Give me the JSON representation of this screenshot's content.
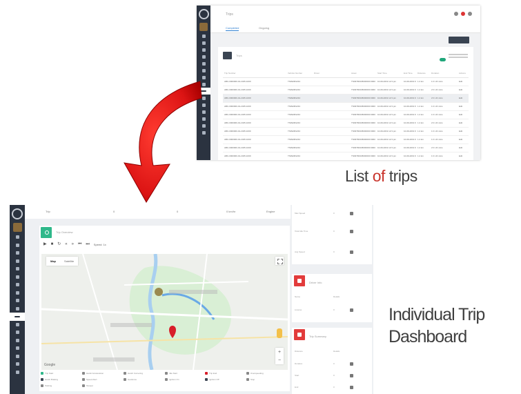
{
  "list_screenshot": {
    "breadcrumb": "Trips",
    "tabs": [
      "Completed",
      "Ongoing"
    ],
    "search_placeholder": "Trips",
    "columns": [
      "Trip Number",
      "Vehicle Number",
      "Driver",
      "Asset",
      "Start Time",
      "End Time",
      "Distance",
      "Duration",
      "Actions"
    ],
    "rows": [
      [
        "ABC-0000000-01-2345-1000",
        "TN09AB1234",
        "TN09782345000000 0000",
        "10-09-2019 12:3 pm",
        "10-09-2019 03:45 pm",
        "1.2 km",
        "1 hr 24 mins",
        "Edit"
      ],
      [
        "ABC-0000000-01-2345-1000",
        "TN09AB1234",
        "TN09782345000000 0000",
        "10-09-2019 12:3 pm",
        "10-09-2019 03:45 pm",
        "1.2 km",
        "2 hr 24 mins",
        "Edit"
      ],
      [
        "ABC-0000000-01-2345-1000",
        "TN09AB1234",
        "TN09782345000000 0000",
        "10-09-2019 12:3 pm",
        "10-09-2019 03:45 pm",
        "1.2 km",
        "2 hr 24 mins",
        "Edit"
      ],
      [
        "ABC-0000000-01-2345-1000",
        "TN09AB1234",
        "TN09782345000000 0000",
        "10-09-2019 12:3 pm",
        "10-09-2019 03:45 pm",
        "1.2 km",
        "1 hr 24 mins",
        "Edit"
      ],
      [
        "ABC-0000000-01-2345-1000",
        "TN09AB1234",
        "TN09782345000000 0000",
        "10-09-2019 12:3 pm",
        "10-09-2019 03:45 pm",
        "1.2 km",
        "1 hr 24 mins",
        "Edit"
      ],
      [
        "ABC-0000000-01-2345-1000",
        "TN09AB1234",
        "TN09782345000000 0000",
        "10-09-2019 12:3 pm",
        "10-09-2019 03:45 pm",
        "1.2 km",
        "2 hr 24 mins",
        "Edit"
      ],
      [
        "ABC-0000000-01-2345-1000",
        "TN09AB1234",
        "TN09782345000000 0000",
        "10-09-2019 12:3 pm",
        "10-09-2019 03:45 pm",
        "1.2 km",
        "1 hr 24 mins",
        "Edit"
      ],
      [
        "ABC-0000000-01-2345-1000",
        "TN09AB1234",
        "TN09782345000000 0000",
        "10-09-2019 12:3 pm",
        "10-09-2019 03:45 pm",
        "1.2 km",
        "1 hr 24 mins",
        "Edit"
      ],
      [
        "ABC-0000000-01-2345-1000",
        "TN09AB1234",
        "TN09782345000000 0000",
        "10-09-2019 12:3 pm",
        "10-09-2019 03:45 pm",
        "1.2 km",
        "2 hr 24 mins",
        "Edit"
      ],
      [
        "ABC-0000000-01-2345-1000",
        "TN09AB1234",
        "TN09782345000000 0000",
        "10-09-2019 12:3 pm",
        "10-09-2019 03:45 pm",
        "1.2 km",
        "1 hr 24 mins",
        "Edit"
      ]
    ],
    "selected_row_index": 2
  },
  "dashboard_screenshot": {
    "topbar": [
      "Trip",
      "0",
      "0",
      "0 km/hr",
      "Engine"
    ],
    "card_title": "Trip Overview",
    "speed_label": "Speed: 1x",
    "map_tabs": [
      "Map",
      "Satellite"
    ],
    "map_watermark": "Google",
    "map_zoom": [
      "+",
      "−"
    ],
    "legend": [
      "Trip Start",
      "Harsh Acceleration",
      "Harsh Cornering",
      "Idle Start",
      "Trip End",
      "Overspeeding",
      "Harsh Braking",
      "Speed Alert",
      "Geofence",
      "Ignition On",
      "Ignition Off",
      "Stop",
      "Parking",
      "Tamper"
    ],
    "side_rows_top": [
      [
        "Max Speed",
        "0",
        ""
      ],
      [
        "Total Idle Time",
        "0",
        ""
      ],
      [
        "Avg Speed",
        "0",
        ""
      ]
    ],
    "section_1": {
      "title": "Driver Info",
      "rows": [
        [
          "Name",
          "Details",
          ""
        ],
        [
          "License",
          "0",
          ""
        ]
      ]
    },
    "section_2": {
      "title": "Trip Summary",
      "rows": [
        [
          "Distance",
          "Details",
          ""
        ],
        [
          "Duration",
          "0",
          ""
        ],
        [
          "Start",
          "0",
          ""
        ],
        [
          "End",
          "0",
          ""
        ]
      ]
    }
  },
  "captions": {
    "list_prefix": "List ",
    "list_of": "of",
    "list_suffix": " trips",
    "dash_line1": "Individual Trip",
    "dash_line2": "Dashboard"
  },
  "colors": {
    "sidebar": "#2b3340",
    "arrow_red": "#e01b1b",
    "accent_green": "#2fb88a",
    "accent_red": "#e23b3b",
    "caption_of": "#c9342c"
  }
}
